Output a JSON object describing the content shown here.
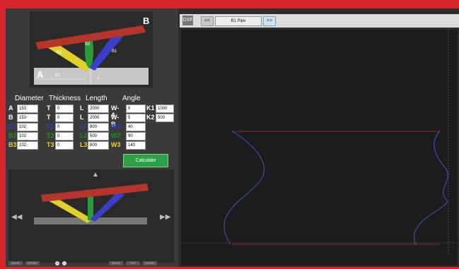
{
  "diagram": {
    "label_b": "B",
    "label_a": "A",
    "label_b3": "B3",
    "label_b2": "B2",
    "label_b1": "B1",
    "label_k1": "K1",
    "label_l": "L"
  },
  "table": {
    "headers": [
      "Diameter",
      "Thickness",
      "Length",
      "Angle"
    ],
    "rows": [
      {
        "d_label": "A",
        "d_val": "153",
        "t_label": "T",
        "t_val": "0",
        "l_label": "L",
        "l_val": "2000",
        "a_label": "W-A",
        "a_val": "0",
        "k_label": "K1",
        "k_val": "1000",
        "color": "#ffffff"
      },
      {
        "d_label": "B",
        "d_val": "153",
        "t_label": "T",
        "t_val": "0",
        "l_label": "L",
        "l_val": "2000",
        "a_label": "W-B",
        "a_val": "5",
        "k_label": "K2",
        "k_val": "500",
        "color": "#ffffff"
      },
      {
        "d_label": "B1",
        "d_val": "102",
        "t_label": "T1",
        "t_val": "0",
        "l_label": "L1",
        "l_val": "800",
        "a_label": "W1",
        "a_val": "40",
        "k_label": "",
        "k_val": "",
        "color": "#2f3cc8"
      },
      {
        "d_label": "B2",
        "d_val": "102",
        "t_label": "T2",
        "t_val": "0",
        "l_label": "L2",
        "l_val": "500",
        "a_label": "W2",
        "a_val": "90",
        "k_label": "",
        "k_val": "",
        "color": "#1f8f2a"
      },
      {
        "d_label": "B3",
        "d_val": "102",
        "t_label": "T3",
        "t_val": "0",
        "l_label": "L3",
        "l_val": "800",
        "a_label": "W3",
        "a_val": "140",
        "k_label": "",
        "k_val": "",
        "color": "#e8d22a"
      }
    ]
  },
  "calculate_label": "Calculate",
  "toolbar": {
    "dxf_label": "DXF",
    "prev_label": "<<",
    "pipe_label": "B1 Pipe",
    "next_label": ">>"
  },
  "bottom_buttons": [
    "BACK",
    "FRONT",
    "+",
    "-",
    "RIGHT",
    "TOP",
    "FRONT"
  ],
  "colors": {
    "frame": "#d7262b",
    "red_pipe": "#b5352a",
    "yellow": "#e0d02a",
    "green": "#2b9a3a",
    "blue": "#3a3ec8",
    "calc_green": "#2ea04a",
    "curve": "#3f58d8",
    "line": "#c0283a"
  }
}
